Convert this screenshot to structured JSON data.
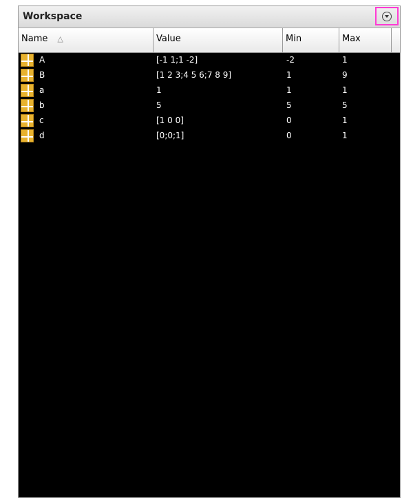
{
  "panel": {
    "title": "Workspace",
    "menu_icon": "chevron-down-circle-icon"
  },
  "columns": {
    "name": "Name",
    "name_sort_indicator": "△",
    "value": "Value",
    "min": "Min",
    "max": "Max"
  },
  "variables": [
    {
      "name": "A",
      "value": "[-1 1;1 -2]",
      "min": "-2",
      "max": "1"
    },
    {
      "name": "B",
      "value": "[1 2 3;4 5 6;7 8 9]",
      "min": "1",
      "max": "9"
    },
    {
      "name": "a",
      "value": "1",
      "min": "1",
      "max": "1"
    },
    {
      "name": "b",
      "value": "5",
      "min": "5",
      "max": "5"
    },
    {
      "name": "c",
      "value": "[1 0 0]",
      "min": "0",
      "max": "1"
    },
    {
      "name": "d",
      "value": "[0;0;1]",
      "min": "0",
      "max": "1"
    }
  ],
  "colors": {
    "highlight_border": "#ff3ad4",
    "table_background": "#000000",
    "variable_icon": "#e8b22e"
  }
}
